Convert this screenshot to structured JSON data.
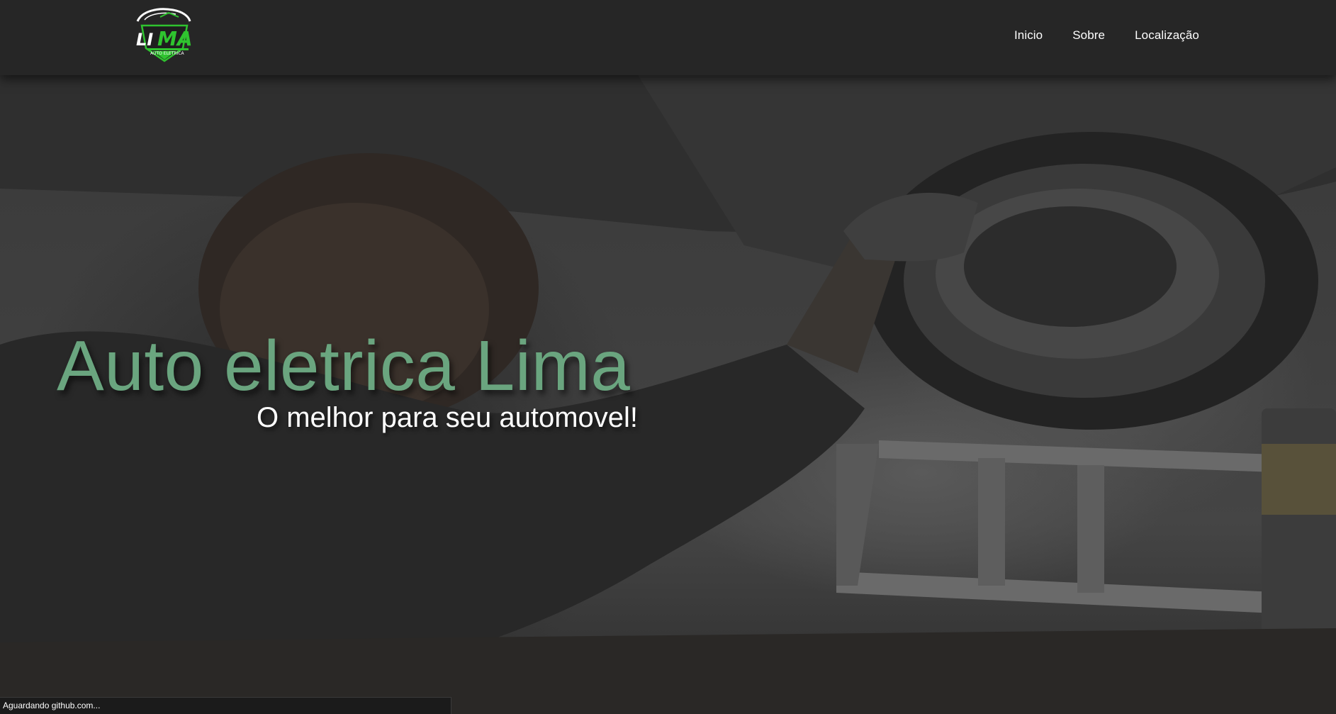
{
  "brand": {
    "logo_text": "LIMA",
    "logo_subtext": "AUTO ELETRICA",
    "accent_color": "#2fc42f"
  },
  "nav": {
    "items": [
      {
        "label": "Inicio"
      },
      {
        "label": "Sobre"
      },
      {
        "label": "Localização"
      }
    ]
  },
  "hero": {
    "title": "Auto eletrica Lima",
    "subtitle": "O melhor para seu automovel!",
    "title_color": "#6aa57f",
    "background_image": "mechanic-under-car-photo"
  },
  "browser_status": {
    "text": "Aguardando github.com..."
  }
}
